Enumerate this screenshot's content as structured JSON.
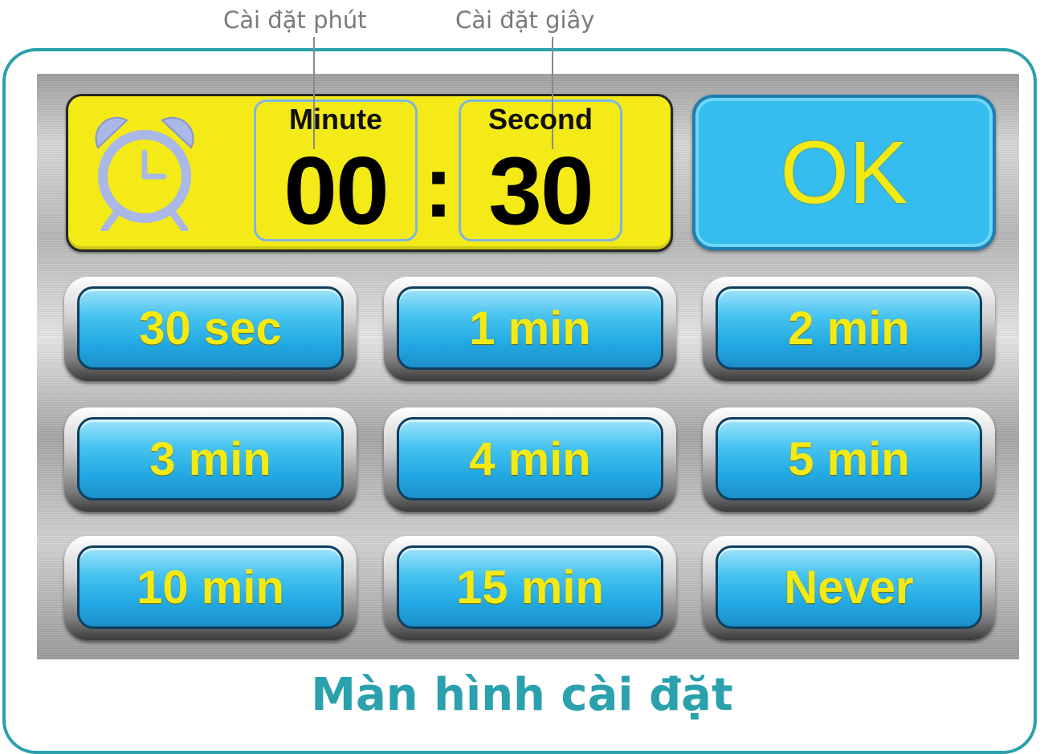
{
  "annotations": {
    "minute_setting": "Cài đặt phút",
    "second_setting": "Cài đặt giây"
  },
  "timer": {
    "icon": "alarm-clock-icon",
    "minute_label": "Minute",
    "second_label": "Second",
    "minute_value": "00",
    "separator": ":",
    "second_value": "30"
  },
  "ok_label": "OK",
  "presets": [
    "30 sec",
    "1 min",
    "2 min",
    "3 min",
    "4 min",
    "5 min",
    "10 min",
    "15 min",
    "Never"
  ],
  "caption": "Màn hình cài đặt",
  "colors": {
    "display_yellow": "#f3ea18",
    "button_blue": "#34bdee",
    "label_yellow": "#f4ea13",
    "frame_teal": "#2aa1ad",
    "icon_blue": "#a9b8e6"
  }
}
